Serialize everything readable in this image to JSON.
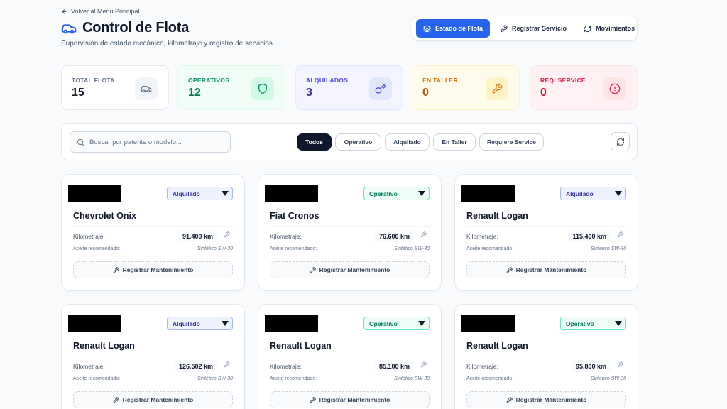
{
  "header": {
    "back_label": "Volver al Menú Principal",
    "title": "Control de Flota",
    "subtitle": "Supervisión de estado mecánico, kilometraje y registro de servicios."
  },
  "nav_tabs": [
    {
      "label": "Estado de Flota",
      "icon": "layers-icon",
      "active": true
    },
    {
      "label": "Registrar Servicio",
      "icon": "wrench-icon",
      "active": false
    },
    {
      "label": "Movimientos",
      "icon": "refresh-icon",
      "active": false
    }
  ],
  "stats": [
    {
      "label": "Total Flota",
      "value": "15",
      "icon": "car-icon",
      "color": "#64748b",
      "bg": "#ffffff",
      "icon_bg": "#f1f5f9",
      "value_color": "#0f172a"
    },
    {
      "label": "Operativos",
      "value": "12",
      "icon": "shield-icon",
      "color": "#059669",
      "bg": "#f0fdf7",
      "icon_bg": "#d1fae5",
      "value_color": "#047857"
    },
    {
      "label": "Alquilados",
      "value": "3",
      "icon": "key-icon",
      "color": "#4f46e5",
      "bg": "#f3f4ff",
      "icon_bg": "#e0e7ff",
      "value_color": "#3730a3"
    },
    {
      "label": "En Taller",
      "value": "0",
      "icon": "wrench-icon",
      "color": "#d97706",
      "bg": "#fffbeb",
      "icon_bg": "#fef3c7",
      "value_color": "#b45309"
    },
    {
      "label": "Req. Service",
      "value": "0",
      "icon": "alert-circle-icon",
      "color": "#e11d48",
      "bg": "#fff1f3",
      "icon_bg": "#ffe4e6",
      "value_color": "#be123c"
    }
  ],
  "filters": {
    "search_placeholder": "Buscar por patente o modelo...",
    "chips": [
      {
        "label": "Todos",
        "active": true
      },
      {
        "label": "Operativo",
        "active": false
      },
      {
        "label": "Alquilado",
        "active": false
      },
      {
        "label": "En Taller",
        "active": false
      },
      {
        "label": "Requiere Service",
        "active": false
      }
    ]
  },
  "labels": {
    "km": "Kilometraje:",
    "oil": "Aceite recomendado:",
    "maintenance_button": "Registrar Mantenimiento"
  },
  "vehicles": [
    {
      "model": "Chevrolet Onix",
      "status": "Alquilado",
      "km": "91.400 km",
      "oil": "Sintético SW-30"
    },
    {
      "model": "Fiat Cronos",
      "status": "Operativo",
      "km": "76.600 km",
      "oil": "Sintético SW-30"
    },
    {
      "model": "Renault Logan",
      "status": "Alquilado",
      "km": "115.400 km",
      "oil": "Sintético SW-30"
    },
    {
      "model": "Renault Logan",
      "status": "Alquilado",
      "km": "126.502 km",
      "oil": "Sintético SW-30"
    },
    {
      "model": "Renault Logan",
      "status": "Operativo",
      "km": "85.100 km",
      "oil": "Sintético SW-30"
    },
    {
      "model": "Renault Logan",
      "status": "Operativo",
      "km": "95.800 km",
      "oil": "Sintético SW-30"
    }
  ],
  "colors": {
    "accent": "#2563eb",
    "dark": "#0f172a"
  }
}
